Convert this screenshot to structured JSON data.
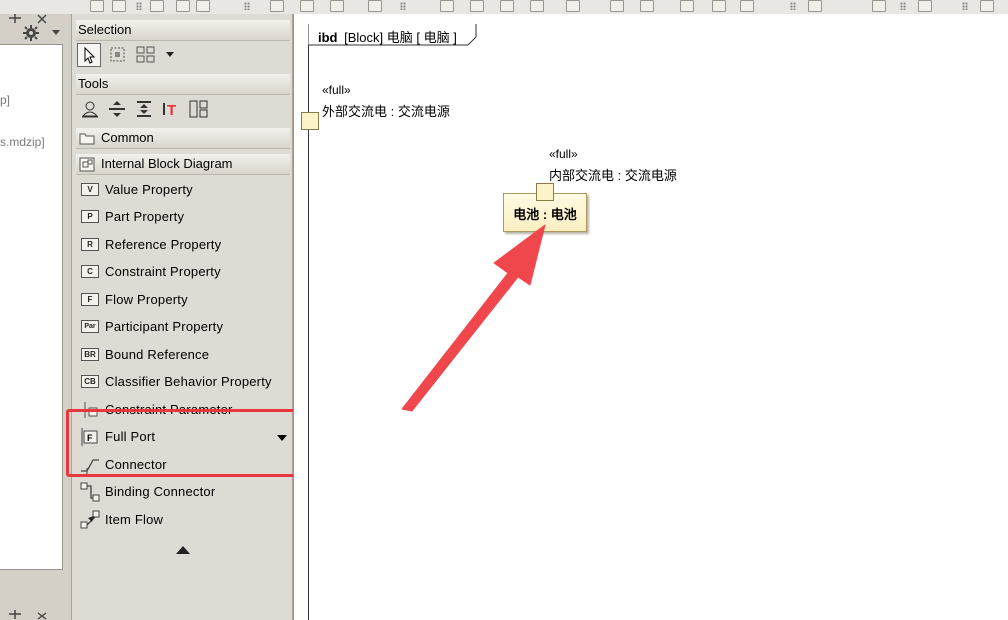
{
  "left_panel": {
    "path_fragment_1": "p]",
    "path_fragment_2": "s.mdzip]"
  },
  "palette": {
    "selection_header": "Selection",
    "tools_header": "Tools",
    "common_group": "Common",
    "ibd_group": "Internal Block Diagram",
    "items": [
      {
        "icon": "V",
        "label": "Value Property"
      },
      {
        "icon": "P",
        "label": "Part Property"
      },
      {
        "icon": "R",
        "label": "Reference Property"
      },
      {
        "icon": "C",
        "label": "Constraint Property"
      },
      {
        "icon": "F",
        "label": "Flow Property"
      },
      {
        "icon": "Par",
        "label": "Participant Property"
      },
      {
        "icon": "BR",
        "label": "Bound Reference"
      },
      {
        "icon": "CB",
        "label": "Classifier Behavior Property"
      },
      {
        "icon": "",
        "label": "Constraint Parameter"
      },
      {
        "icon": "F",
        "label": "Full Port"
      },
      {
        "icon": "",
        "label": "Connector"
      },
      {
        "icon": "",
        "label": "Binding Connector"
      },
      {
        "icon": "",
        "label": "Item Flow"
      }
    ]
  },
  "diagram": {
    "tab_kind": "ibd",
    "tab_title": "[Block] 电脑 [ 电脑 ]",
    "port_external": {
      "stereotype": "«full»",
      "name": "外部交流电 : 交流电源"
    },
    "port_internal": {
      "stereotype": "«full»",
      "name": "内部交流电 : 交流电源"
    },
    "part_label": "电池 : 电池"
  },
  "colors": {
    "highlight": "#e8383d",
    "arrow": "#f0474d",
    "port_fill": "#fdf3c8"
  }
}
